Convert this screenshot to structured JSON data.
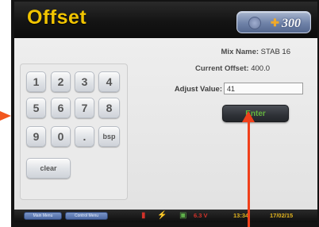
{
  "header": {
    "title": "Offset",
    "logo_text": "300",
    "logo_icon": "cross-icon"
  },
  "keypad": {
    "keys": [
      "1",
      "2",
      "3",
      "4",
      "5",
      "6",
      "7",
      "8",
      "9",
      "0",
      ".",
      "bsp",
      "clear"
    ]
  },
  "info": {
    "mix_name_label": "Mix Name:",
    "mix_name_value": "STAB 16",
    "current_offset_label": "Current Offset:",
    "current_offset_value": "400.0",
    "adjust_value_label": "Adjust Value:",
    "adjust_value": "41"
  },
  "enter_button": {
    "label": "Enter"
  },
  "status_bar": {
    "button_1": "Main Menu",
    "button_2": "Control Menu",
    "voltage": "6.3 V",
    "time": "13:34",
    "date": "17/02/15"
  },
  "colors": {
    "title": "#f1c400",
    "enter_text": "#64b33e",
    "voltage": "#d2322a",
    "annotation_arrow": "#f0401b"
  }
}
